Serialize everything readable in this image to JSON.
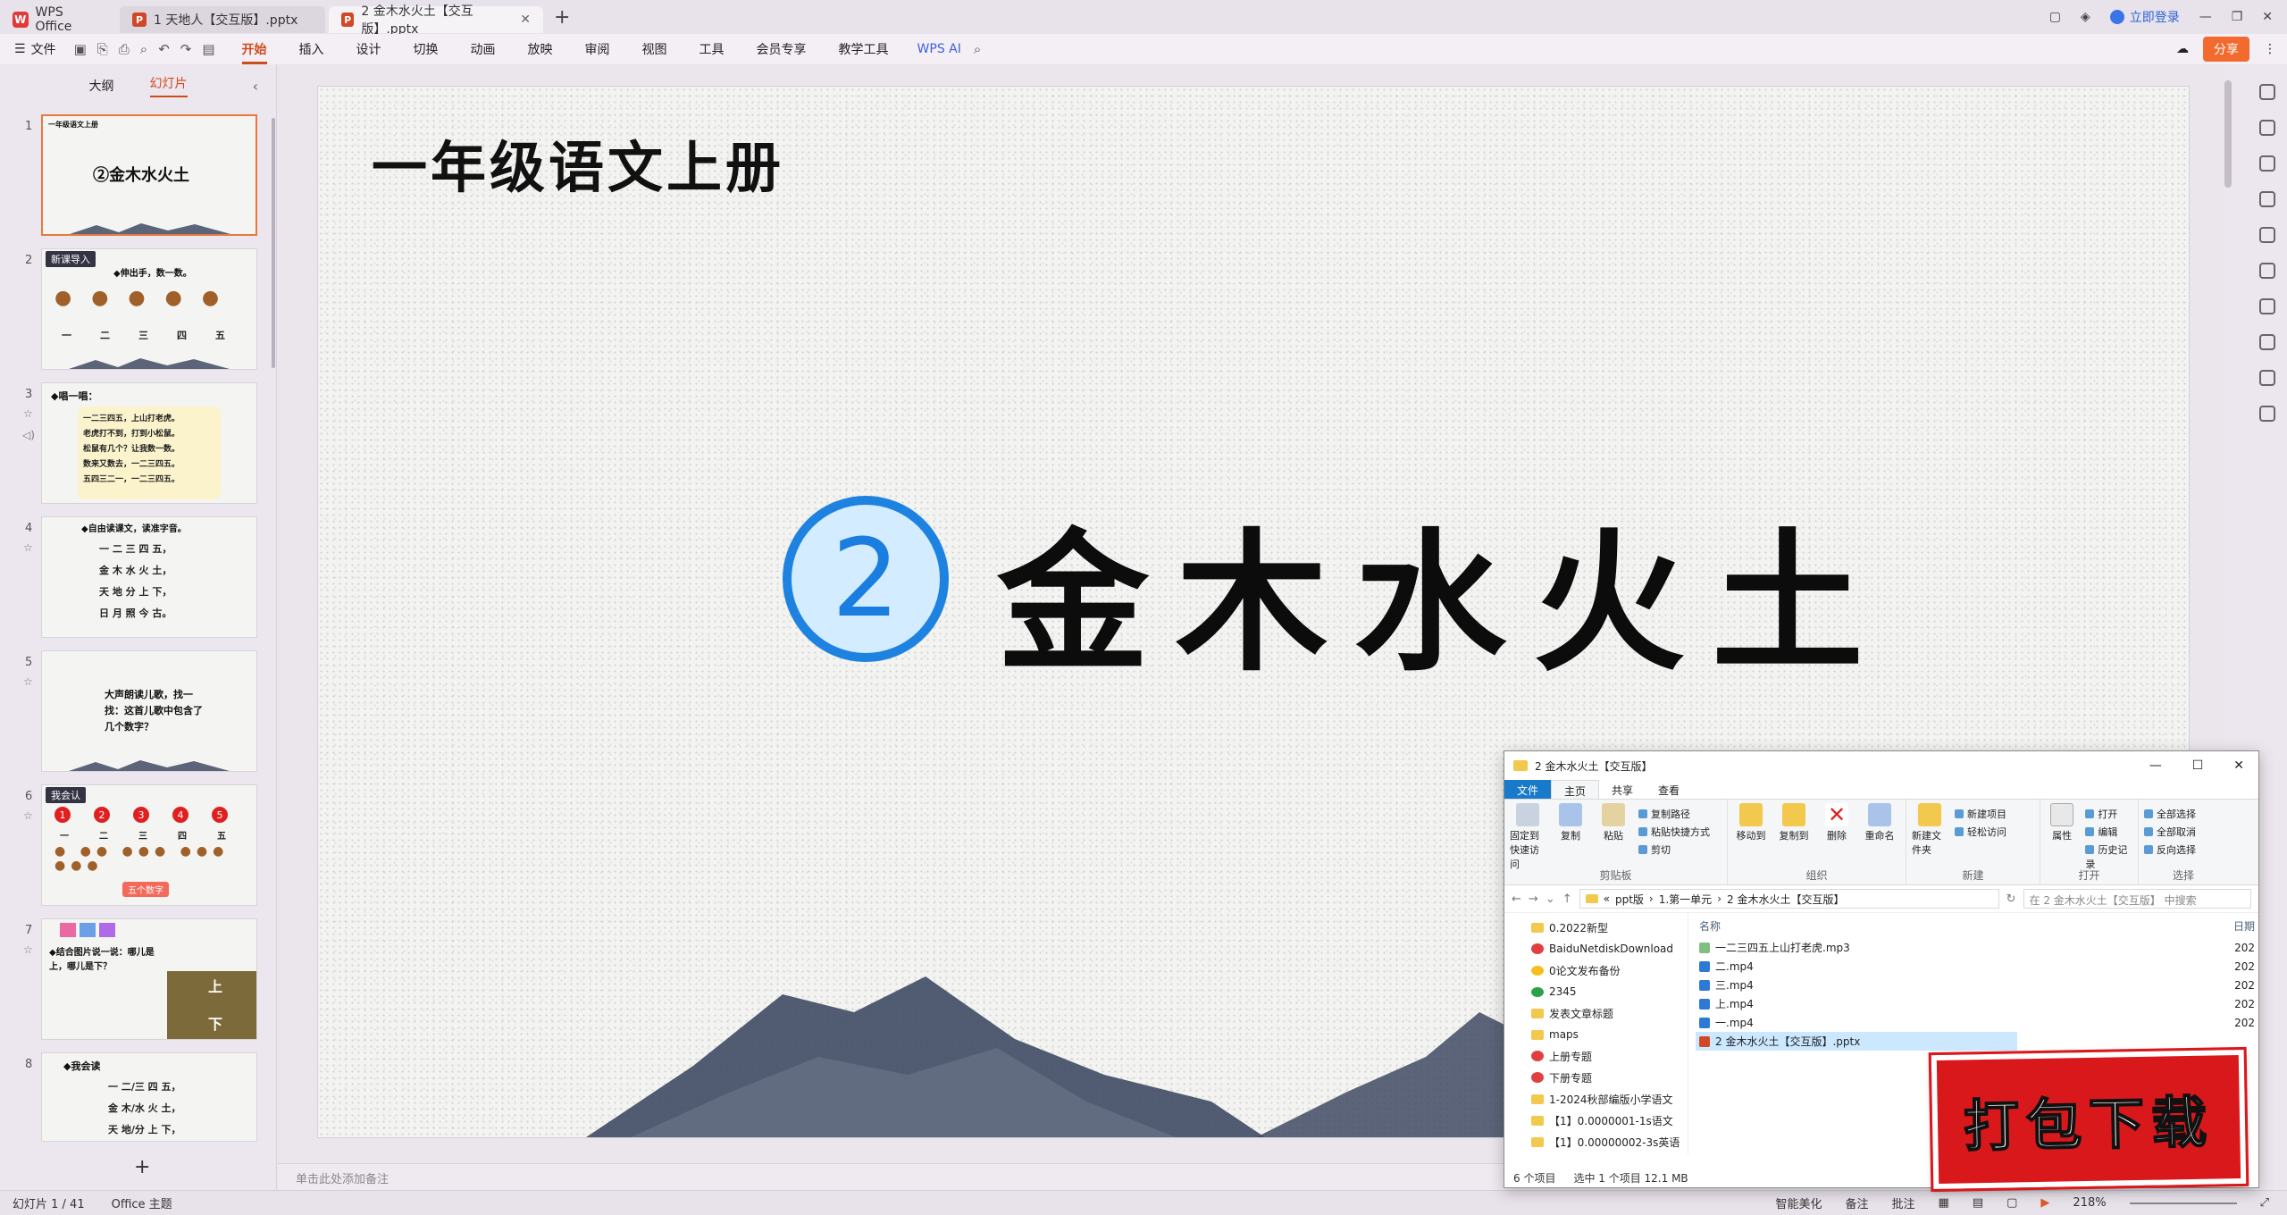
{
  "titlebar": {
    "home_tab": "WPS Office",
    "tabs": [
      {
        "label": "1 天地人【交互版】.pptx"
      },
      {
        "label": "2 金木水火土【交互版】.pptx"
      }
    ],
    "login": "立即登录"
  },
  "menubar": {
    "file": "文件",
    "items": [
      "开始",
      "插入",
      "设计",
      "切换",
      "动画",
      "放映",
      "审阅",
      "视图",
      "工具",
      "会员专享",
      "教学工具"
    ],
    "active": "开始",
    "ai": "WPS AI",
    "share": "分享"
  },
  "leftpane": {
    "tabs": [
      "大纲",
      "幻灯片"
    ],
    "slides": [
      {
        "num": "1",
        "text": "②金木水火土",
        "header": "一年级语文上册"
      },
      {
        "num": "2",
        "text": "◆伸出手，数一数。",
        "badge": "新课导入",
        "row": [
          "一",
          "二",
          "三",
          "四",
          "五"
        ]
      },
      {
        "num": "3",
        "text": "◆唱一唱：",
        "poem": [
          "一二三四五，上山打老虎。",
          "老虎打不到，打到小松鼠。",
          "松鼠有几个？让我数一数。",
          "数来又数去，一二三四五。",
          "五四三二一，一二三四五。"
        ]
      },
      {
        "num": "4",
        "text": "◆自由读课文，读准字音。",
        "lines": [
          "一 二 三 四 五，",
          "金 木 水 火 土，",
          "天 地 分 上 下，",
          "日 月 照 今 古。"
        ]
      },
      {
        "num": "5",
        "text": "大声朗读儿歌，找一找：这首儿歌中包含了几个数字？"
      },
      {
        "num": "6",
        "badge": "我会认",
        "row": [
          "一",
          "二",
          "三",
          "四",
          "五"
        ],
        "nums": [
          "1",
          "2",
          "3",
          "4",
          "5"
        ],
        "tag": "五个数字"
      },
      {
        "num": "7",
        "text": "◆结合图片说一说：哪儿是上，哪儿是下？",
        "words": [
          "上",
          "下"
        ]
      },
      {
        "num": "8",
        "text": "◆我会读",
        "lines": [
          "一 二/三 四 五，",
          "金 木/水 火 土，",
          "天 地/分 上 下，"
        ]
      }
    ]
  },
  "slide": {
    "header": "一年级语文上册",
    "lesson_number": "2",
    "lesson_title": "金木水火土",
    "notes_placeholder": "单击此处添加备注"
  },
  "statusbar": {
    "slide_count": "幻灯片 1 / 41",
    "theme": "Office 主题",
    "smart": "智能美化",
    "notes": "备注",
    "comments": "批注",
    "zoom": "218%"
  },
  "explorer": {
    "title": "2 金木水火土【交互版】",
    "ribbon_tabs": [
      "文件",
      "主页",
      "共享",
      "查看"
    ],
    "groups": [
      {
        "label": "剪贴板",
        "buttons": [
          "固定到快速访问",
          "复制",
          "粘贴"
        ],
        "small": [
          "复制路径",
          "粘贴快捷方式",
          "剪切"
        ]
      },
      {
        "label": "组织",
        "buttons": [
          "移动到",
          "复制到",
          "删除",
          "重命名"
        ]
      },
      {
        "label": "新建",
        "buttons": [
          "新建文件夹"
        ],
        "small": [
          "新建项目",
          "轻松访问"
        ]
      },
      {
        "label": "打开",
        "buttons": [
          "属性"
        ],
        "small": [
          "打开",
          "编辑",
          "历史记录"
        ]
      },
      {
        "label": "选择",
        "small": [
          "全部选择",
          "全部取消",
          "反向选择"
        ]
      }
    ],
    "path": [
      "ppt版",
      "1.第一单元",
      "2 金木水火土【交互版】"
    ],
    "search_placeholder": "在 2 金木水火土【交互版】 中搜索",
    "nav": [
      "0.2022新型",
      "BaiduNetdiskDownload",
      "0论文发布备份",
      "2345",
      "发表文章标题",
      "maps",
      "上册专题",
      "下册专题",
      "1-2024秋部编版小学语文",
      "【1】0.0000001-1s语文",
      "【1】0.00000002-3s英语"
    ],
    "column_name": "名称",
    "column_date": "日期",
    "files": [
      {
        "name": "一二三四五上山打老虎.mp3",
        "type": "mp3",
        "date": "202"
      },
      {
        "name": "二.mp4",
        "type": "mp4",
        "date": "202"
      },
      {
        "name": "三.mp4",
        "type": "mp4",
        "date": "202"
      },
      {
        "name": "上.mp4",
        "type": "mp4",
        "date": "202"
      },
      {
        "name": "一.mp4",
        "type": "mp4",
        "date": "202"
      },
      {
        "name": "2 金木水火土【交互版】.pptx",
        "type": "pptx",
        "date": "202",
        "selected": true
      }
    ],
    "status_items": "6 个项目",
    "status_selected": "选中 1 个项目  12.1 MB"
  },
  "stamp": "打包下载",
  "colors": {
    "accent": "#d04a1c",
    "lesson_blue": "#1e82e0",
    "stamp_red": "#d9181c"
  }
}
